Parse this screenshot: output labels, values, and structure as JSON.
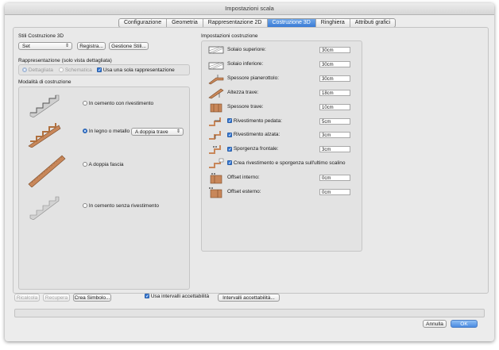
{
  "window": {
    "title": "Impostazioni scala"
  },
  "tabs": [
    {
      "label": "Configurazione",
      "active": false
    },
    {
      "label": "Geometria",
      "active": false
    },
    {
      "label": "Rappresentazione 2D",
      "active": false
    },
    {
      "label": "Costruzione 3D",
      "active": true
    },
    {
      "label": "Ringhiera",
      "active": false
    },
    {
      "label": "Attributi grafici",
      "active": false
    }
  ],
  "stili": {
    "title": "Stili Costruzione 3D",
    "set_value": "Set",
    "registra_label": "Registra...",
    "gestione_label": "Gestione Stili..."
  },
  "rappresentazione": {
    "title": "Rappresentazione (solo vista dettagliata)",
    "dettagliata_label": "Dettagliata",
    "schematica_label": "Schematica",
    "usa_sola_label": "Usa una sola rappresentazione"
  },
  "modalita": {
    "title": "Modalità di costruzione",
    "options": [
      {
        "label": "In cemento con rivestimento",
        "selected": false
      },
      {
        "label": "In legno o metallo",
        "selected": true
      },
      {
        "label": "A doppia fascia",
        "selected": false
      },
      {
        "label": "In cemento senza rivestimento",
        "selected": false
      }
    ],
    "trave_value": "A doppia trave"
  },
  "impostazioni": {
    "title": "Impostazioni costruzione",
    "rows": [
      {
        "label": "Solaio superiore:",
        "value": "30cm",
        "icon": "solaio-superiore-icon"
      },
      {
        "label": "Solaio inferiore:",
        "value": "30cm",
        "icon": "solaio-inferiore-icon"
      },
      {
        "label": "Spessore pianerottolo:",
        "value": "30cm",
        "icon": "pianerottolo-icon"
      },
      {
        "label": "Altezza trave:",
        "value": "18cm",
        "icon": "altezza-trave-icon"
      },
      {
        "label": "Spessore trave:",
        "value": "10cm",
        "icon": "spessore-trave-icon"
      },
      {
        "label": "Rivestimento pedata:",
        "value": "5cm",
        "icon": "rivestimento-pedata-icon",
        "checkbox": true
      },
      {
        "label": "Rivestimento alzata:",
        "value": "3cm",
        "icon": "rivestimento-alzata-icon",
        "checkbox": true
      },
      {
        "label": "Sporgenza frontale:",
        "value": "3cm",
        "icon": "sporgenza-frontale-icon",
        "checkbox": true
      },
      {
        "label": "Crea rivestimento e sporgenza sull'ultimo scalino",
        "value": "",
        "icon": "ultimo-scalino-icon",
        "checkbox": true
      },
      {
        "label": "Offset interno:",
        "value": "0cm",
        "icon": "offset-interno-icon"
      },
      {
        "label": "Offset esterno:",
        "value": "0cm",
        "icon": "offset-esterno-icon"
      }
    ]
  },
  "bottom": {
    "ricalcola_label": "Ricalcola",
    "recupera_label": "Recupera",
    "crea_simbolo_label": "Crea Simbolo...",
    "usa_intervalli_label": "Usa intervalli accettabilità",
    "intervalli_label": "Intervalli accettabilità...",
    "annulla_label": "Annulla",
    "ok_label": "OK"
  },
  "colors": {
    "accent": "#3a7bd5",
    "wood": "#c8875a"
  }
}
